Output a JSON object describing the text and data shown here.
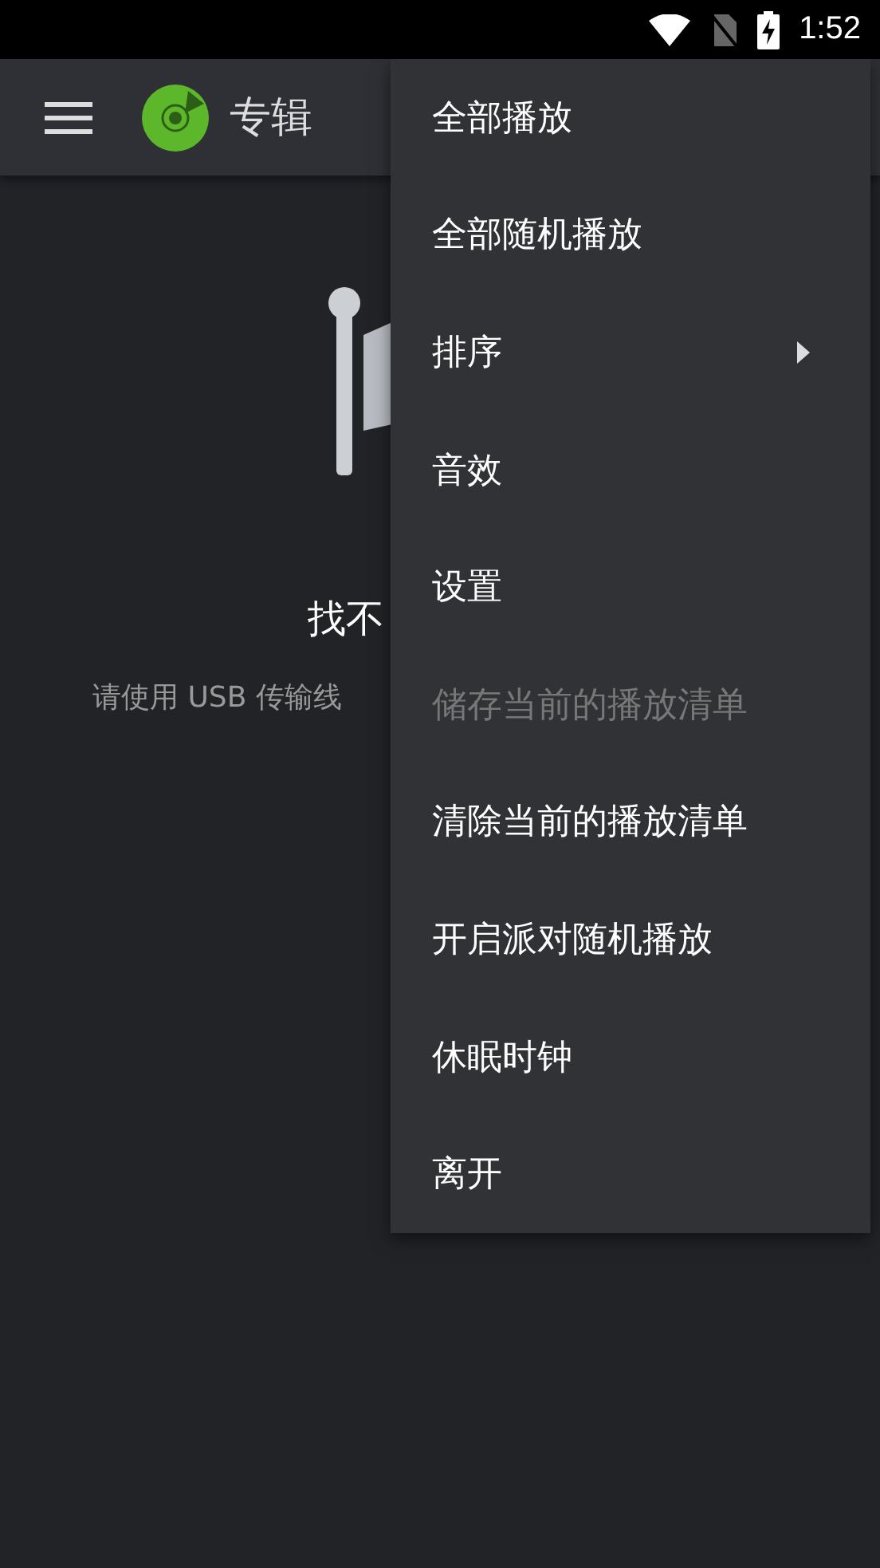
{
  "status_bar": {
    "time": "1:52"
  },
  "app_bar": {
    "title": "专辑"
  },
  "empty_state": {
    "title": "找不",
    "message": "请使用 USB 传输线"
  },
  "menu": {
    "items": [
      {
        "label": "全部播放",
        "disabled": false,
        "has_submenu": false
      },
      {
        "label": "全部随机播放",
        "disabled": false,
        "has_submenu": false
      },
      {
        "label": "排序",
        "disabled": false,
        "has_submenu": true
      },
      {
        "label": "音效",
        "disabled": false,
        "has_submenu": false
      },
      {
        "label": "设置",
        "disabled": false,
        "has_submenu": false
      },
      {
        "label": "储存当前的播放清单",
        "disabled": true,
        "has_submenu": false
      },
      {
        "label": "清除当前的播放清单",
        "disabled": false,
        "has_submenu": false
      },
      {
        "label": "开启派对随机播放",
        "disabled": false,
        "has_submenu": false
      },
      {
        "label": "休眠时钟",
        "disabled": false,
        "has_submenu": false
      },
      {
        "label": "离开",
        "disabled": false,
        "has_submenu": false
      }
    ]
  }
}
